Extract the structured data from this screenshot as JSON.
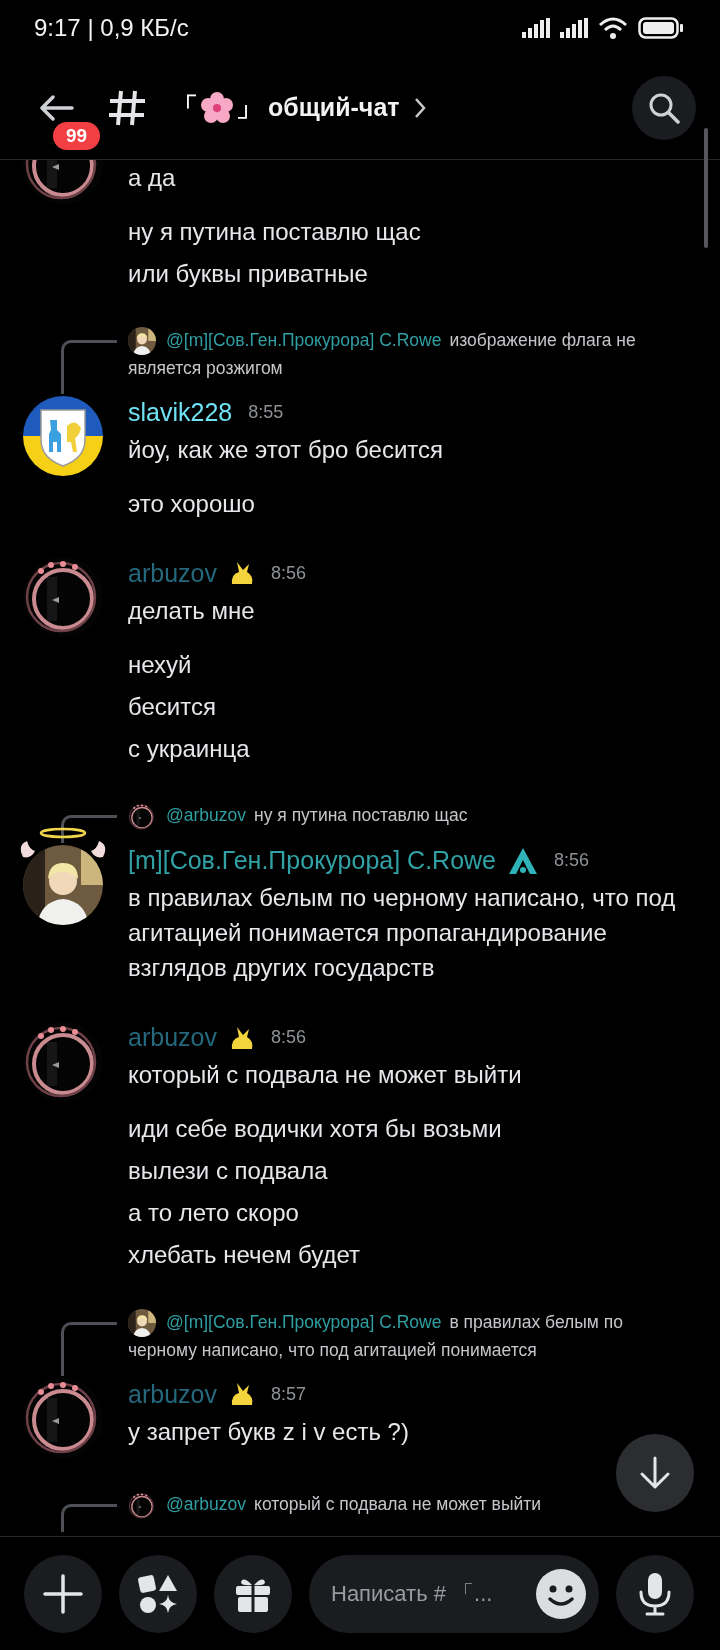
{
  "status_bar": {
    "time": "9:17 | 0,9 КБ/с"
  },
  "header": {
    "unread_badge": "99",
    "bracket_open": "「",
    "bracket_close": "」",
    "channel_name": "общий-чат"
  },
  "messages": [
    {
      "avatar": {
        "kind": "ring"
      },
      "lines": [
        "а да",
        "ну я путина поставлю щас",
        "или буквы приватные"
      ]
    },
    {
      "reply": {
        "avatar": {
          "kind": "figure"
        },
        "author": "@[m][Сов.Ген.Прокурора] C.Rowe",
        "text": [
          "изображение флага не",
          "является розжигом"
        ]
      },
      "avatar": {
        "kind": "emblem"
      },
      "author": "slavik228",
      "color": "#6fe2f4",
      "time": "8:55",
      "lines": [
        "йоу, как же этот бро бесится",
        "это хорошо"
      ]
    },
    {
      "avatar": {
        "kind": "ring"
      },
      "author": "arbuzov",
      "color": "#24697d",
      "badge": {
        "kind": "critter"
      },
      "time": "8:56",
      "lines": [
        "делать мне",
        "нехуй",
        "бесится",
        "с украинца"
      ]
    },
    {
      "reply": {
        "avatar": {
          "kind": "ring"
        },
        "author": "@arbuzov",
        "text": [
          "ну я путина поставлю щас"
        ]
      },
      "avatar": {
        "kind": "figure"
      },
      "author": "[m][Сов.Ген.Прокурора] C.Rowe",
      "color": "#30a2a6",
      "badge": {
        "kind": "peak"
      },
      "time": "8:56",
      "lines": [
        "в правилах белым по черному написано, что под агитацией понимается пропагандирование взглядов других государств"
      ]
    },
    {
      "avatar": {
        "kind": "ring"
      },
      "author": "arbuzov",
      "color": "#24697d",
      "badge": {
        "kind": "critter"
      },
      "time": "8:56",
      "lines": [
        "который с подвала не может выйти",
        "иди себе водички хотя бы возьми",
        "вылези с подвала",
        "а то лето скоро",
        "хлебать нечем будет"
      ]
    },
    {
      "reply": {
        "avatar": {
          "kind": "figure"
        },
        "author": "@[m][Сов.Ген.Прокурора] C.Rowe",
        "text": [
          "в правилах белым по",
          "черному написано, что под агитацией понимается"
        ]
      },
      "avatar": {
        "kind": "ring"
      },
      "author": "arbuzov",
      "color": "#24697d",
      "badge": {
        "kind": "critter"
      },
      "time": "8:57",
      "lines": [
        "у запрет букв z i v есть ?)"
      ]
    },
    {
      "reply": {
        "avatar": {
          "kind": "ring"
        },
        "author": "@arbuzov",
        "text": [
          "который с подвала не может выйти"
        ]
      }
    }
  ],
  "composer": {
    "placeholder": "Написать # 「..."
  }
}
